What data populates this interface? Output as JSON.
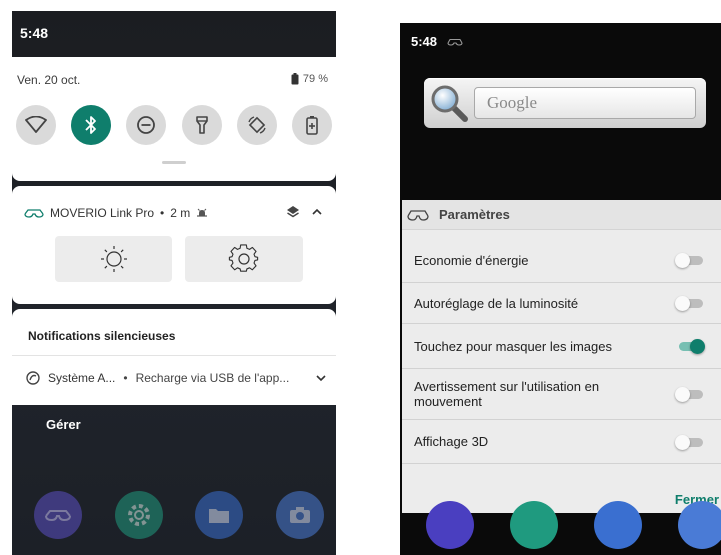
{
  "left_phone": {
    "status_bar": {
      "time": "5:48"
    },
    "quick_settings": {
      "date": "Ven. 20 oct.",
      "battery_percent": "79 %",
      "tiles": [
        {
          "icon": "wifi-icon",
          "active": false
        },
        {
          "icon": "bluetooth-icon",
          "active": true
        },
        {
          "icon": "do-not-disturb-icon",
          "active": false
        },
        {
          "icon": "flashlight-icon",
          "active": false
        },
        {
          "icon": "auto-rotate-icon",
          "active": false
        },
        {
          "icon": "battery-saver-icon",
          "active": false
        }
      ]
    },
    "notification": {
      "app_name": "MOVERIO Link Pro",
      "separator": "•",
      "time": "2 m",
      "actions": [
        {
          "icon": "brightness-icon"
        },
        {
          "icon": "settings-gear-icon"
        }
      ]
    },
    "silent_notifications": {
      "title": "Notifications silencieuses",
      "item": {
        "app": "Système A...",
        "separator": "•",
        "text": "Recharge via USB de l'app..."
      }
    },
    "manage_label": "Gérer",
    "dock": [
      {
        "icon": "moverio-app-icon",
        "color": "#5b4fc4"
      },
      {
        "icon": "settings-app-icon",
        "color": "#1f9a7f"
      },
      {
        "icon": "files-app-icon",
        "color": "#3a6fd0"
      },
      {
        "icon": "camera-app-icon",
        "color": "#4a7bd6"
      }
    ]
  },
  "right_phone": {
    "status_bar": {
      "time": "5:48"
    },
    "google_widget": {
      "placeholder": "Google"
    },
    "settings_panel": {
      "title": "Paramètres",
      "items": [
        {
          "label": "Economie d'énergie",
          "enabled": false
        },
        {
          "label": "Autoréglage de la luminosité",
          "enabled": false
        },
        {
          "label": "Touchez pour masquer les images",
          "enabled": true
        },
        {
          "label": "Avertissement sur l'utilisation en mouvement",
          "enabled": false
        },
        {
          "label": "Affichage 3D",
          "enabled": false
        }
      ],
      "close_label": "Fermer"
    },
    "dock_colors": [
      "#4a3fc0",
      "#1f9a7f",
      "#3a6fd0",
      "#4a7bd6"
    ]
  },
  "colors": {
    "accent": "#0f7e6c",
    "panel": "#ececec",
    "dark": "#1c2027"
  }
}
